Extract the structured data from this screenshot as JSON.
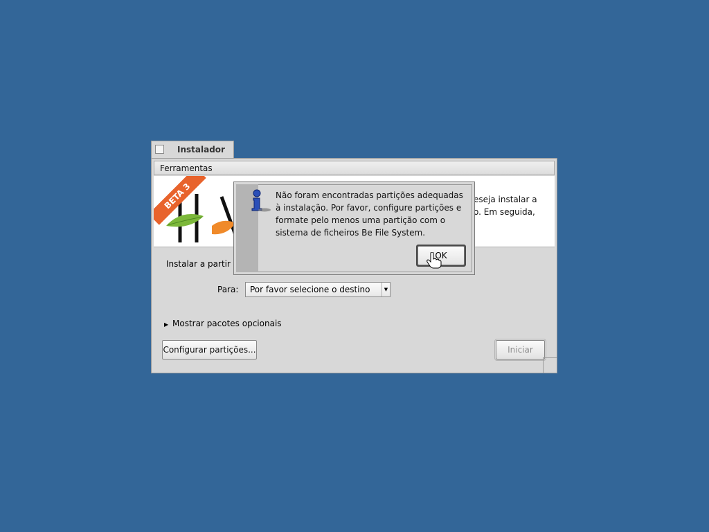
{
  "window": {
    "title": "Instalador",
    "menu": {
      "tools": "Ferramentas"
    },
    "banner": {
      "ribbon": "BETA 3",
      "text_line1": "eseja instalar a",
      "text_line2": "o. Em seguida,"
    },
    "install_from_label": "Instalar a partir de",
    "to_label": "Para:",
    "destination": {
      "value": "Por favor selecione o destino"
    },
    "optional_packages_toggle": "Mostrar pacotes opcionais",
    "buttons": {
      "configure_partitions": "Configurar partições...",
      "start": "Iniciar"
    }
  },
  "alert": {
    "message": "Não foram encontradas partições adequadas à instalação. Por favor, configure partições e formate pelo menos uma partição com o sistema de ficheiros Be File System.",
    "ok_label": "OK",
    "icon": "info-icon"
  },
  "colors": {
    "desktop": "#336698",
    "accent_ribbon": "#e8632c",
    "icon_blue": "#2a4fb8"
  }
}
